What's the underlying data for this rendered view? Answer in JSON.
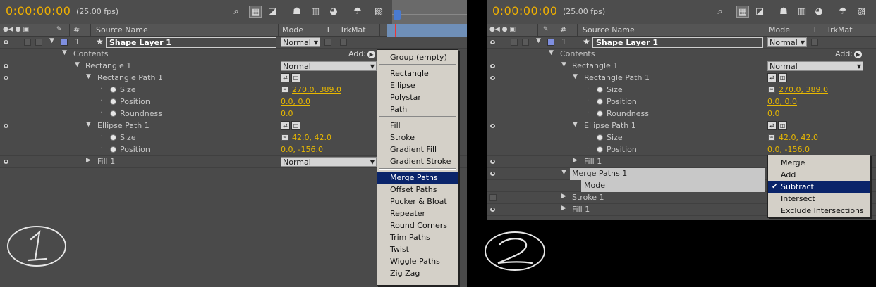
{
  "timecode": "0:00:00:00",
  "fps": "(25.00 fps)",
  "headers": {
    "hash": "#",
    "source_name": "Source Name",
    "mode": "Mode",
    "t": "T",
    "trkmat": "TrkMat"
  },
  "layer": {
    "number": "1",
    "name": "Shape Layer 1",
    "mode": "Normal",
    "color": "#7f8fe0"
  },
  "contents": {
    "label": "Contents",
    "add_label": "Add:"
  },
  "rectangle_group": {
    "label": "Rectangle 1",
    "mode": "Normal"
  },
  "rectangle_path": {
    "label": "Rectangle Path 1",
    "size_label": "Size",
    "size_value": "270.0, 389.0",
    "position_label": "Position",
    "position_value": "0.0, 0.0",
    "roundness_label": "Roundness",
    "roundness_value": "0.0"
  },
  "ellipse_path": {
    "label": "Ellipse Path 1",
    "size_label": "Size",
    "size_value": "42.0, 42.0",
    "position_label": "Position",
    "position_value": "0.0, -156.0"
  },
  "fill": {
    "label": "Fill 1",
    "mode": "Normal"
  },
  "merge_paths": {
    "label": "Merge Paths 1",
    "mode_label": "Mode"
  },
  "stroke": {
    "label": "Stroke 1"
  },
  "add_menu": {
    "items": [
      {
        "label": "Group (empty)"
      },
      {
        "label": "Rectangle"
      },
      {
        "label": "Ellipse"
      },
      {
        "label": "Polystar"
      },
      {
        "label": "Path"
      },
      {
        "label": "Fill"
      },
      {
        "label": "Stroke"
      },
      {
        "label": "Gradient Fill"
      },
      {
        "label": "Gradient Stroke"
      },
      {
        "label": "Merge Paths"
      },
      {
        "label": "Offset Paths"
      },
      {
        "label": "Pucker & Bloat"
      },
      {
        "label": "Repeater"
      },
      {
        "label": "Round Corners"
      },
      {
        "label": "Trim Paths"
      },
      {
        "label": "Twist"
      },
      {
        "label": "Wiggle Paths"
      },
      {
        "label": "Zig Zag"
      }
    ],
    "selected": "Merge Paths"
  },
  "mode_menu": {
    "items": [
      {
        "label": "Merge"
      },
      {
        "label": "Add"
      },
      {
        "label": "Subtract"
      },
      {
        "label": "Intersect"
      },
      {
        "label": "Exclude Intersections"
      }
    ],
    "selected": "Subtract"
  },
  "colors": {
    "timecode": "#f0b000",
    "value": "#e8b800",
    "panel": "#4a4a4a",
    "menu": "#d4d0c8",
    "menu_selected": "#0a246a"
  }
}
